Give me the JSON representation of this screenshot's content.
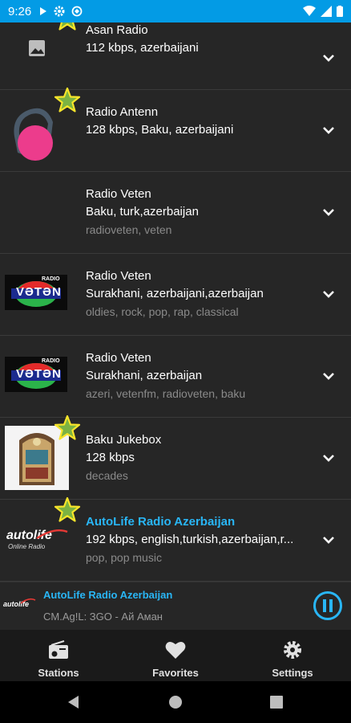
{
  "status_bar": {
    "time": "9:26"
  },
  "stations": [
    {
      "name": "Asan Radio",
      "meta": "112 kbps, azerbaijani",
      "tags": "",
      "favorite": true,
      "thumb": "placeholder-image"
    },
    {
      "name": "Radio Antenn",
      "meta": "128 kbps, Baku, azerbaijani",
      "tags": "",
      "favorite": true,
      "thumb": "antenn-logo"
    },
    {
      "name": "Radio Veten",
      "meta": "Baku, turk,azerbaijan",
      "tags": "radioveten, veten",
      "favorite": false,
      "thumb": "none"
    },
    {
      "name": "Radio Veten",
      "meta": "Surakhani, azerbaijani,azerbaijan",
      "tags": "oldies, rock, pop, rap, classical",
      "favorite": false,
      "thumb": "veten-logo"
    },
    {
      "name": "Radio Veten",
      "meta": "Surakhani, azerbaijan",
      "tags": "azeri, vetenfm, radioveten, baku",
      "favorite": false,
      "thumb": "veten-logo"
    },
    {
      "name": "Baku Jukebox",
      "meta": "128 kbps",
      "tags": "decades",
      "favorite": true,
      "thumb": "jukebox-image"
    },
    {
      "name": "AutoLife Radio Azerbaijan",
      "meta": "192 kbps, english,turkish,azerbaijan,r...",
      "tags": "pop, pop music",
      "favorite": true,
      "thumb": "autolife-logo",
      "active": true
    }
  ],
  "logos": {
    "veten_text": "VƏTƏN",
    "veten_small": "RADIO",
    "autolife_text": "autolife",
    "autolife_sub": "Online Radio"
  },
  "player": {
    "title": "AutoLife Radio Azerbaijan",
    "subtitle": "CM.Ag!L: ЗGO - Ай Аман"
  },
  "bottom_nav": {
    "stations": "Stations",
    "favorites": "Favorites",
    "settings": "Settings"
  },
  "colors": {
    "accent": "#29b6f6",
    "status_bar": "#039be5",
    "star_fill": "#7cb342",
    "star_stroke": "#f9e52a"
  }
}
